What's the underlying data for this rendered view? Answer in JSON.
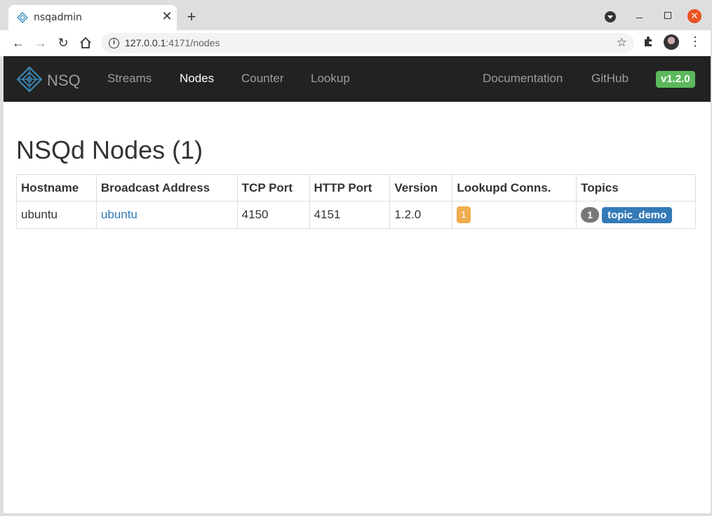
{
  "browser": {
    "tab_title": "nsqadmin",
    "url_host": "127.0.0.1",
    "url_rest": ":4171/nodes",
    "icons": {
      "back": "arrow-left-icon",
      "forward": "arrow-right-icon",
      "reload": "reload-icon",
      "home": "home-icon",
      "info": "info-icon",
      "star": "star-icon",
      "extensions": "puzzle-icon",
      "menu": "kebab-menu-icon"
    }
  },
  "navbar": {
    "brand": "NSQ",
    "links": [
      "Streams",
      "Nodes",
      "Counter",
      "Lookup"
    ],
    "active": "Nodes",
    "right_links": [
      "Documentation",
      "GitHub"
    ],
    "version": "v1.2.0",
    "colors": {
      "background": "#222222",
      "version_badge": "#5cb85c"
    }
  },
  "page": {
    "title": "NSQd Nodes (1)"
  },
  "table": {
    "headers": [
      "Hostname",
      "Broadcast Address",
      "TCP Port",
      "HTTP Port",
      "Version",
      "Lookupd Conns.",
      "Topics"
    ],
    "rows": [
      {
        "hostname": "ubuntu",
        "broadcast_address": "ubuntu",
        "tcp_port": "4150",
        "http_port": "4151",
        "version": "1.2.0",
        "lookupd_conns": "1",
        "topic_count": "1",
        "topics": [
          "topic_demo"
        ]
      }
    ],
    "colors": {
      "lookupd_badge": "#f0ad4e",
      "topic_count_badge": "#777777",
      "topic_badge": "#337ab7",
      "link": "#337ab7"
    }
  }
}
